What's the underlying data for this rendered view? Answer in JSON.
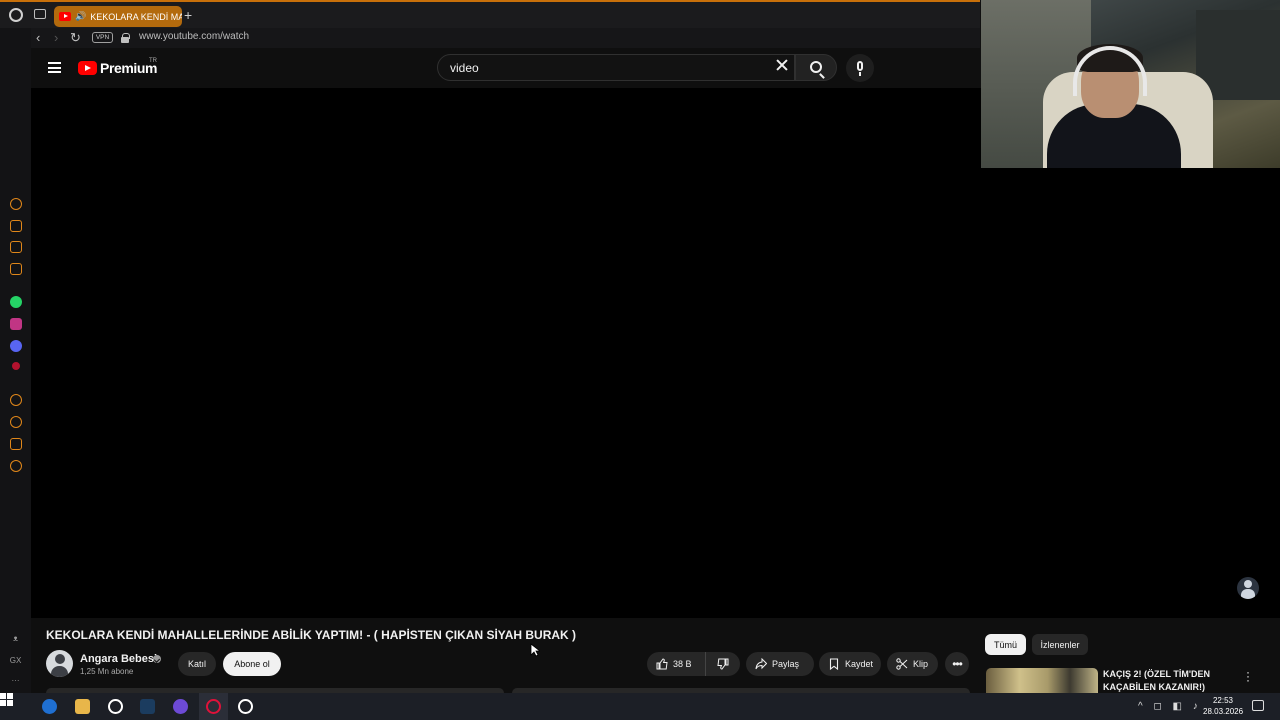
{
  "browser": {
    "tab_title": "KEKOLARA KENDİ MA",
    "new_tab_label": "+",
    "url": "www.youtube.com/watch",
    "vpn_label": "VPN"
  },
  "sidebar": {
    "bottom_items": [
      "ᴥ",
      "GX",
      "···"
    ]
  },
  "masthead": {
    "logo_text": "Premium",
    "country_code": "TR",
    "search_value": "video"
  },
  "video": {
    "title": "KEKOLARA KENDİ MAHALLELERİNDE ABİLİK YAPTIM! - ( HAPİSTEN ÇIKAN SİYAH BURAK )",
    "channel_name": "Angara Bebesi",
    "subscriber_count": "1,25 Mn abone",
    "join_label": "Katıl",
    "subscribe_label": "Abone ol",
    "like_count": "38 B",
    "share_label": "Paylaş",
    "save_label": "Kaydet",
    "clip_label": "Klip",
    "more_label": "•••"
  },
  "related": {
    "chips": [
      "Tümü",
      "İzlenenler"
    ],
    "first_title": "KAÇIŞ 2! (ÖZEL TİM'DEN KAÇABİLEN KAZANIR!)"
  },
  "taskbar": {
    "time": "22:53",
    "date": "28.03.2026",
    "tray_icons": [
      "^",
      "◻",
      "◧",
      "🔊"
    ]
  },
  "colors": {
    "browser_accent": "#c8700a",
    "youtube_red": "#ff0000",
    "page_background": "#0f0f0f"
  }
}
